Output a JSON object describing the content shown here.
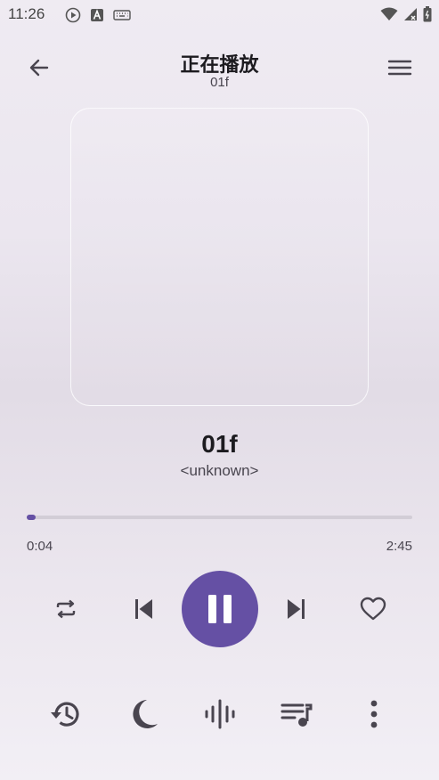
{
  "status_bar": {
    "time": "11:26",
    "icons": [
      "play-circle-icon",
      "a-letter-icon",
      "keyboard-icon"
    ],
    "right_icons": [
      "wifi-icon",
      "cell-signal-icon",
      "battery-icon"
    ]
  },
  "header": {
    "title": "正在播放",
    "subtitle": "01f",
    "back_icon": "arrow-left-icon",
    "menu_icon": "hamburger-menu-icon"
  },
  "track": {
    "title": "01f",
    "artist": "<unknown>"
  },
  "progress": {
    "current": "0:04",
    "total": "2:45",
    "fraction": 0.024
  },
  "controls": {
    "repeat": "repeat-icon",
    "previous": "skip-previous-icon",
    "play_pause": "pause-icon",
    "next": "skip-next-icon",
    "favorite": "heart-outline-icon"
  },
  "bottom_bar": {
    "history": "history-icon",
    "sleep": "moon-icon",
    "equalizer": "waveform-icon",
    "queue": "queue-music-icon",
    "more": "more-vertical-icon"
  },
  "colors": {
    "accent": "#6550a4",
    "icon": "#49454f",
    "text": "#1c1b1f"
  }
}
